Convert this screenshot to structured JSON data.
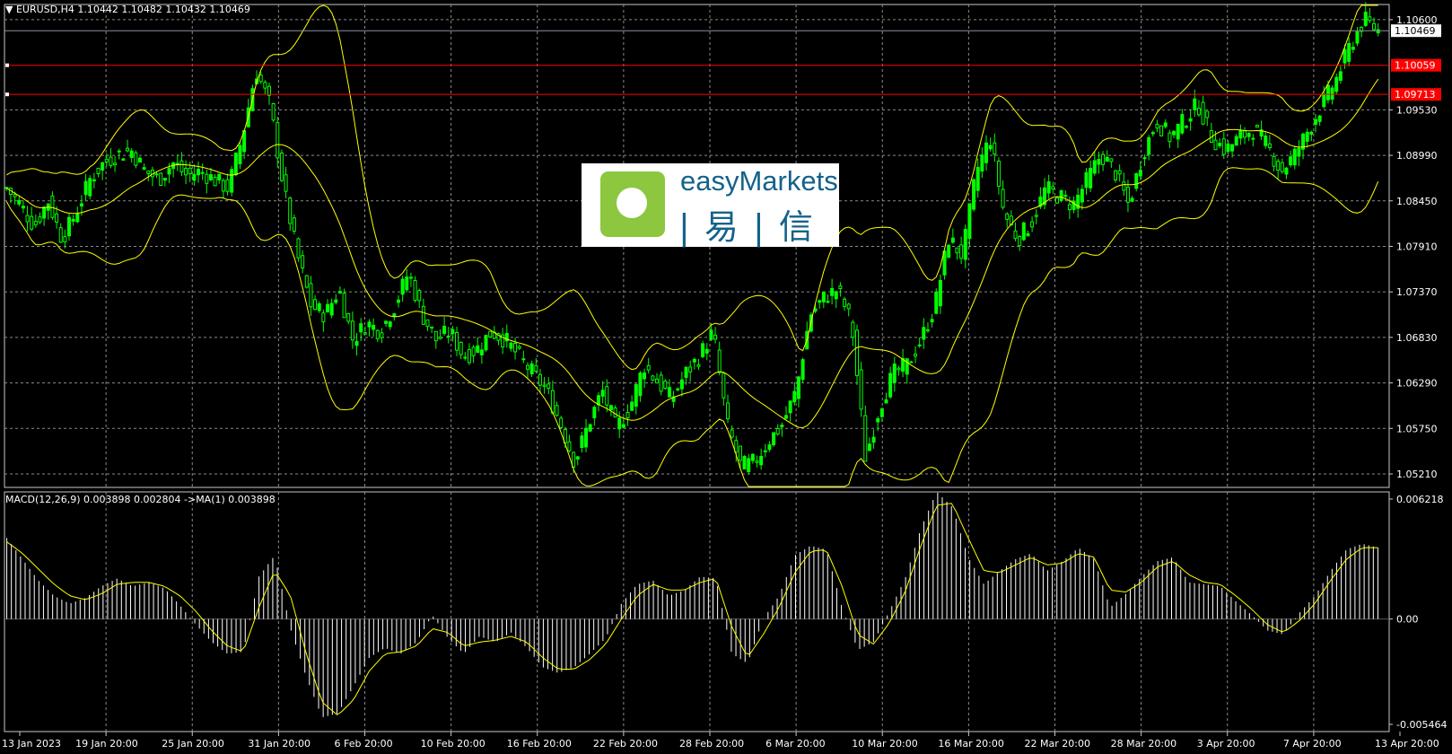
{
  "header": {
    "symbol_line": "EURUSD,H4  1.10442 1.10482 1.10432 1.10469",
    "macd_line": "MACD(12,26,9) 0.003898 0.002804  ->MA(1) 0.003898"
  },
  "logo": {
    "name": "easyMarkets",
    "chinese": "| 易 | 信"
  },
  "colors": {
    "background": "#000000",
    "candle": "#00ff00",
    "bands": "#ffff00",
    "level_line": "#ff0000",
    "price_line": "#8a8fa0",
    "grid": "#8a8a8a",
    "histogram": "#ffffff",
    "signal": "#ffff00"
  },
  "chart_data": [
    {
      "type": "candlestick",
      "title": "EURUSD,H4",
      "ylim": [
        1.0505,
        1.1078
      ],
      "y_ticks": [
        "1.10600",
        "1.09530",
        "1.08990",
        "1.08450",
        "1.07910",
        "1.07370",
        "1.06830",
        "1.06290",
        "1.05750",
        "1.05210"
      ],
      "x_ticks": [
        "13 Jan 2023",
        "19 Jan 20:00",
        "25 Jan 20:00",
        "31 Jan 20:00",
        "6 Feb 20:00",
        "10 Feb 20:00",
        "16 Feb 20:00",
        "22 Feb 20:00",
        "28 Feb 20:00",
        "6 Mar 20:00",
        "10 Mar 20:00",
        "16 Mar 20:00",
        "22 Mar 20:00",
        "28 Mar 20:00",
        "3 Apr 20:00",
        "7 Apr 20:00",
        "13 Apr 20:00"
      ],
      "close_path": [
        1.086,
        1.084,
        1.0815,
        1.0845,
        1.08,
        1.083,
        1.087,
        1.089,
        1.09,
        1.0905,
        1.088,
        1.087,
        1.089,
        1.0875,
        1.088,
        1.087,
        1.086,
        1.092,
        1.1,
        1.096,
        1.086,
        1.078,
        1.072,
        1.071,
        1.074,
        1.068,
        1.07,
        1.069,
        1.072,
        1.076,
        1.071,
        1.068,
        1.069,
        1.066,
        1.067,
        1.069,
        1.068,
        1.066,
        1.064,
        1.062,
        1.058,
        1.0535,
        1.058,
        1.062,
        1.0575,
        1.06,
        1.065,
        1.063,
        1.061,
        1.064,
        1.066,
        1.069,
        1.058,
        1.053,
        1.0535,
        1.056,
        1.058,
        1.062,
        1.071,
        1.073,
        1.074,
        1.07,
        1.054,
        1.06,
        1.064,
        1.065,
        1.068,
        1.072,
        1.08,
        1.078,
        1.088,
        1.092,
        1.083,
        1.08,
        1.082,
        1.086,
        1.085,
        1.084,
        1.087,
        1.09,
        1.088,
        1.084,
        1.09,
        1.094,
        1.092,
        1.094,
        1.096,
        1.092,
        1.0905,
        1.092,
        1.093,
        1.091,
        1.088,
        1.09,
        1.093,
        1.096,
        1.099,
        1.103,
        1.106,
        1.1047
      ],
      "levels": [
        {
          "label": "1.10469",
          "value": 1.10469,
          "style": "current"
        },
        {
          "label": "1.10059",
          "value": 1.10059,
          "style": "red"
        },
        {
          "label": "1.09713",
          "value": 1.09713,
          "style": "red"
        }
      ],
      "band_width": 0.0045
    },
    {
      "type": "histogram",
      "title": "MACD(12,26,9)",
      "ylim": [
        -0.005464,
        0.006218
      ],
      "y_ticks": [
        "0.006218",
        "0.00",
        "-0.005464"
      ],
      "values": [
        0.0042,
        0.0031,
        0.002,
        0.0012,
        0.0008,
        0.0011,
        0.0017,
        0.0021,
        0.0017,
        0.0019,
        0.0016,
        0.0007,
        -0.0003,
        -0.0012,
        -0.0018,
        -0.0017,
        0.0022,
        0.0033,
        -0.0005,
        -0.003,
        -0.0051,
        -0.0049,
        -0.0035,
        -0.002,
        -0.0015,
        -0.0018,
        -0.0012,
        0.0002,
        -0.001,
        -0.0018,
        -0.0009,
        -0.0012,
        -0.0007,
        -0.0015,
        -0.0025,
        -0.0028,
        -0.0025,
        -0.0018,
        -0.001,
        0.0008,
        0.0018,
        0.002,
        0.0012,
        0.0015,
        0.0022,
        0.0021,
        -0.0018,
        -0.0023,
        0.0,
        0.0012,
        0.0033,
        0.0038,
        0.0036,
        0.0006,
        -0.0016,
        -0.0012,
        0.0004,
        0.0021,
        0.0047,
        0.0066,
        0.0058,
        0.0032,
        0.0018,
        0.0025,
        0.0031,
        0.0034,
        0.0025,
        0.003,
        0.0037,
        0.0031,
        0.0006,
        0.0013,
        0.0022,
        0.003,
        0.0032,
        0.0019,
        0.0018,
        0.0017,
        0.0009,
        0.0002,
        -0.0006,
        -0.0008,
        0.0003,
        0.0012,
        0.0025,
        0.0036,
        0.0039,
        0.0037
      ],
      "signal": [
        0.004,
        0.0034,
        0.0026,
        0.0018,
        0.0012,
        0.001,
        0.0013,
        0.0018,
        0.0019,
        0.0019,
        0.0017,
        0.0012,
        0.0004,
        -0.0006,
        -0.0014,
        -0.0017,
        0.0006,
        0.0025,
        0.0012,
        -0.0018,
        -0.0043,
        -0.005,
        -0.0042,
        -0.0027,
        -0.0018,
        -0.0017,
        -0.0014,
        -0.0005,
        -0.0007,
        -0.0014,
        -0.0012,
        -0.0011,
        -0.0009,
        -0.0012,
        -0.002,
        -0.0026,
        -0.0026,
        -0.0021,
        -0.0013,
        0.0,
        0.0012,
        0.0018,
        0.0015,
        0.0015,
        0.0019,
        0.0021,
        -0.0004,
        -0.002,
        -0.0008,
        0.0006,
        0.0024,
        0.0035,
        0.0036,
        0.0017,
        -0.0008,
        -0.0013,
        -0.0002,
        0.0014,
        0.0038,
        0.0059,
        0.006,
        0.0042,
        0.0025,
        0.0024,
        0.0028,
        0.0032,
        0.0028,
        0.0029,
        0.0034,
        0.0032,
        0.0015,
        0.0014,
        0.0019,
        0.0027,
        0.003,
        0.0023,
        0.0019,
        0.0018,
        0.0012,
        0.0005,
        -0.0003,
        -0.0007,
        -0.0001,
        0.0008,
        0.002,
        0.0031,
        0.0037,
        0.0037
      ]
    }
  ]
}
